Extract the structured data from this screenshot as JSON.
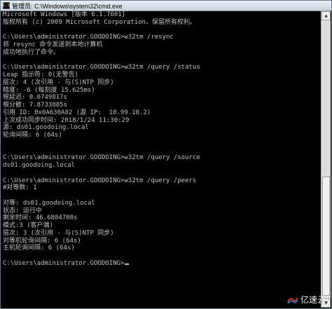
{
  "window": {
    "title": "管理员: C:\\Windows\\system32\\cmd.exe",
    "icon": "cmd-icon"
  },
  "console": {
    "lines": [
      "Microsoft Windows [版本 6.1.7601]",
      "版权所有 (c) 2009 Microsoft Corporation。保留所有权利。",
      "",
      "C:\\Users\\administrator.GOODOING>w32tm /resync",
      "将 resync 命令发送到本地计算机",
      "成功地执行了命令。",
      "",
      "C:\\Users\\administrator.GOODOING>w32tm /query /status",
      "Leap 指示符: 0(无警告)",
      "层次: 4 (次引用 - 与(S)NTP 同步)",
      "精度: -6 (每刻度 15.625ms)",
      "根延迟: 0.0749817s",
      "根分散: 7.8733885s",
      "引用 ID: 0x0A630A02 (源 IP:  10.99.10.2)",
      "上次成功同步时间: 2018/1/24 11:30:29",
      "源: ds01.goodoing.local",
      "轮询间隔: 6 (64s)",
      "",
      "",
      "C:\\Users\\administrator.GOODOING>w32tm /query /source",
      "ds01.goodoing.local",
      "",
      "C:\\Users\\administrator.GOODOING>w32tm /query /peers",
      "#对等数: 1",
      "",
      "对等: ds01.goodoing.local",
      "状态: 运行中",
      "剩余时间: 46.6804708s",
      "模式:3 (客户端)",
      "层次: 3 (次引用 - 与(S)NTP 同步)",
      "对等机轮询间隔: 6 (64s)",
      "主机轮询间隔: 6 (64s)",
      "",
      "C:\\Users\\administrator.GOODOING>"
    ]
  },
  "scrollbar": {
    "up_icon": "arrow-up-icon",
    "down_icon": "arrow-down-icon",
    "up_glyph": "▲",
    "down_glyph": "▼"
  },
  "watermark": {
    "text": "亿速云",
    "logo": "yisu-logo-icon"
  }
}
